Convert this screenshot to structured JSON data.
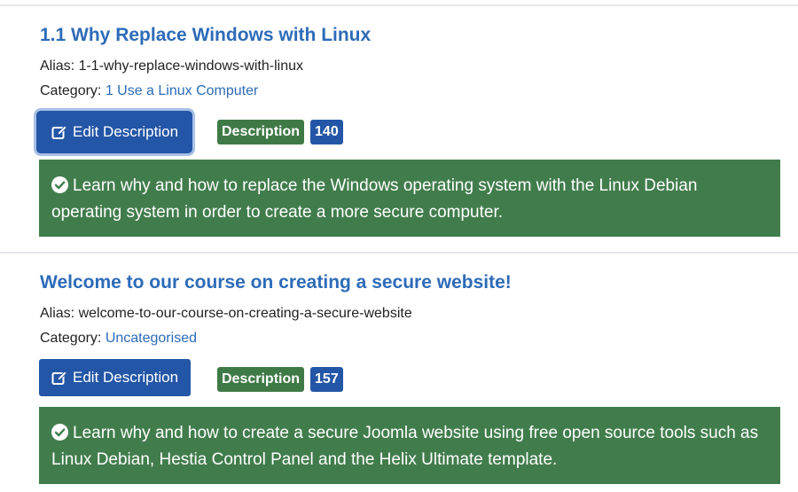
{
  "labels": {
    "alias_prefix": "Alias: ",
    "category_prefix": "Category: ",
    "edit_button": "Edit Description",
    "description_badge": "Description"
  },
  "articles": [
    {
      "title": "1.1 Why Replace Windows with Linux",
      "alias": "1-1-why-replace-windows-with-linux",
      "category": "1 Use a Linux Computer",
      "description_length": "140",
      "description": "Learn why and how to replace the Windows operating system with the Linux Debian operating system in order to create a more secure computer."
    },
    {
      "title": "Welcome to our course on creating a secure website!",
      "alias": "welcome-to-our-course-on-creating-a-secure-website",
      "category": "Uncategorised",
      "description_length": "157",
      "description": "Learn why and how to create a secure Joomla website using free open source tools such as Linux Debian, Hestia Control Panel and the Helix Ultimate template."
    }
  ],
  "colors": {
    "link": "#2d6bb8",
    "button": "#2356a6",
    "success_badge": "#3f7a46",
    "description_box": "#417d4c"
  },
  "icons": {
    "edit": "pen-to-square-icon",
    "description_status": "check-circle-icon"
  }
}
